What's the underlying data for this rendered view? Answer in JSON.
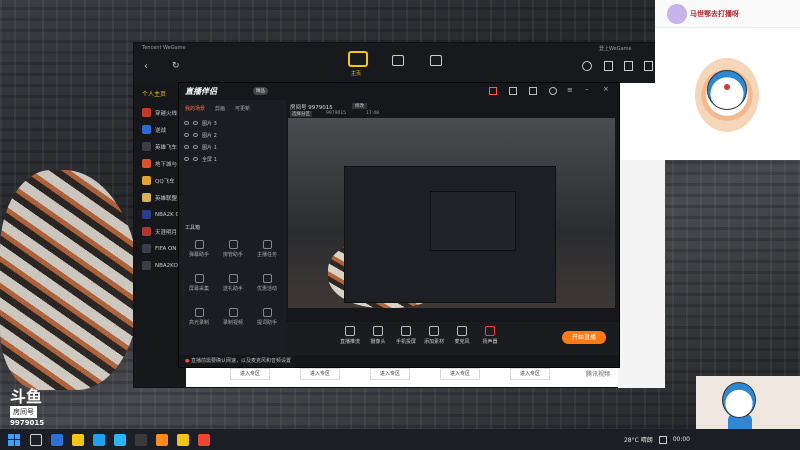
{
  "desktop": {
    "watermark": {
      "logo": "斗鱼",
      "room_label": "房间号",
      "room_number": "9979015"
    }
  },
  "tencent_window": {
    "title": "Tencent WeGame",
    "tabs": [
      "主页"
    ],
    "top_right": "登上WeGame",
    "sidebar_header": "个人主页",
    "games": [
      {
        "name": "穿越火线",
        "color": "#c23b2a"
      },
      {
        "name": "逆战",
        "color": "#2b6bd6"
      },
      {
        "name": "英雄飞车",
        "color": "#3a3f47"
      },
      {
        "name": "地下城与",
        "color": "#d9542a"
      },
      {
        "name": "QQ飞车",
        "color": "#e0a234"
      },
      {
        "name": "英雄联盟",
        "color": "#d7b256"
      },
      {
        "name": "NBA2K O",
        "color": "#2b3c88"
      },
      {
        "name": "天涯明月",
        "color": "#b23434"
      },
      {
        "name": "FIFA ON",
        "color": "#3a3f47"
      },
      {
        "name": "NBA2KO",
        "color": "#3a3f47"
      }
    ],
    "enter_buttons": [
      "进入专区",
      "进入专区",
      "进入专区",
      "进入专区",
      "进入专区"
    ],
    "bottom_text": "腾讯视频"
  },
  "live_window": {
    "brand": "直播伴侣",
    "badge": "精品",
    "room_info": "房间号 9979015",
    "edit_label": "修改",
    "status_left": "选择分区",
    "status_code": "9979015",
    "status_time": "17:48",
    "tabs": [
      "我的场景",
      "剪画",
      "可更新"
    ],
    "sources": [
      "图片 3",
      "图片 2",
      "图片 1",
      "全屏 1"
    ],
    "tools_label": "工具箱",
    "tools": [
      {
        "label": "弹幕助手"
      },
      {
        "label": "房管助手"
      },
      {
        "label": "主播任务"
      },
      {
        "label": "屏幕采集"
      },
      {
        "label": "送礼助手"
      },
      {
        "label": "优惠活动"
      },
      {
        "label": "高光录制"
      },
      {
        "label": "录制视频"
      },
      {
        "label": "提词助手"
      }
    ],
    "controls": [
      {
        "label": "直播推流"
      },
      {
        "label": "摄像头"
      },
      {
        "label": "手机投屏"
      },
      {
        "label": "添加素材"
      },
      {
        "label": "麦克风"
      },
      {
        "label": "扬声器"
      }
    ],
    "start_button": "开始直播",
    "notice": "直播前需要确认网速，以及麦克风和音频设置"
  },
  "cam_panel": {
    "title": "马世鄂去打播呀"
  },
  "taskbar": {
    "weather": "28°C 晴朗",
    "time": "00:00"
  }
}
